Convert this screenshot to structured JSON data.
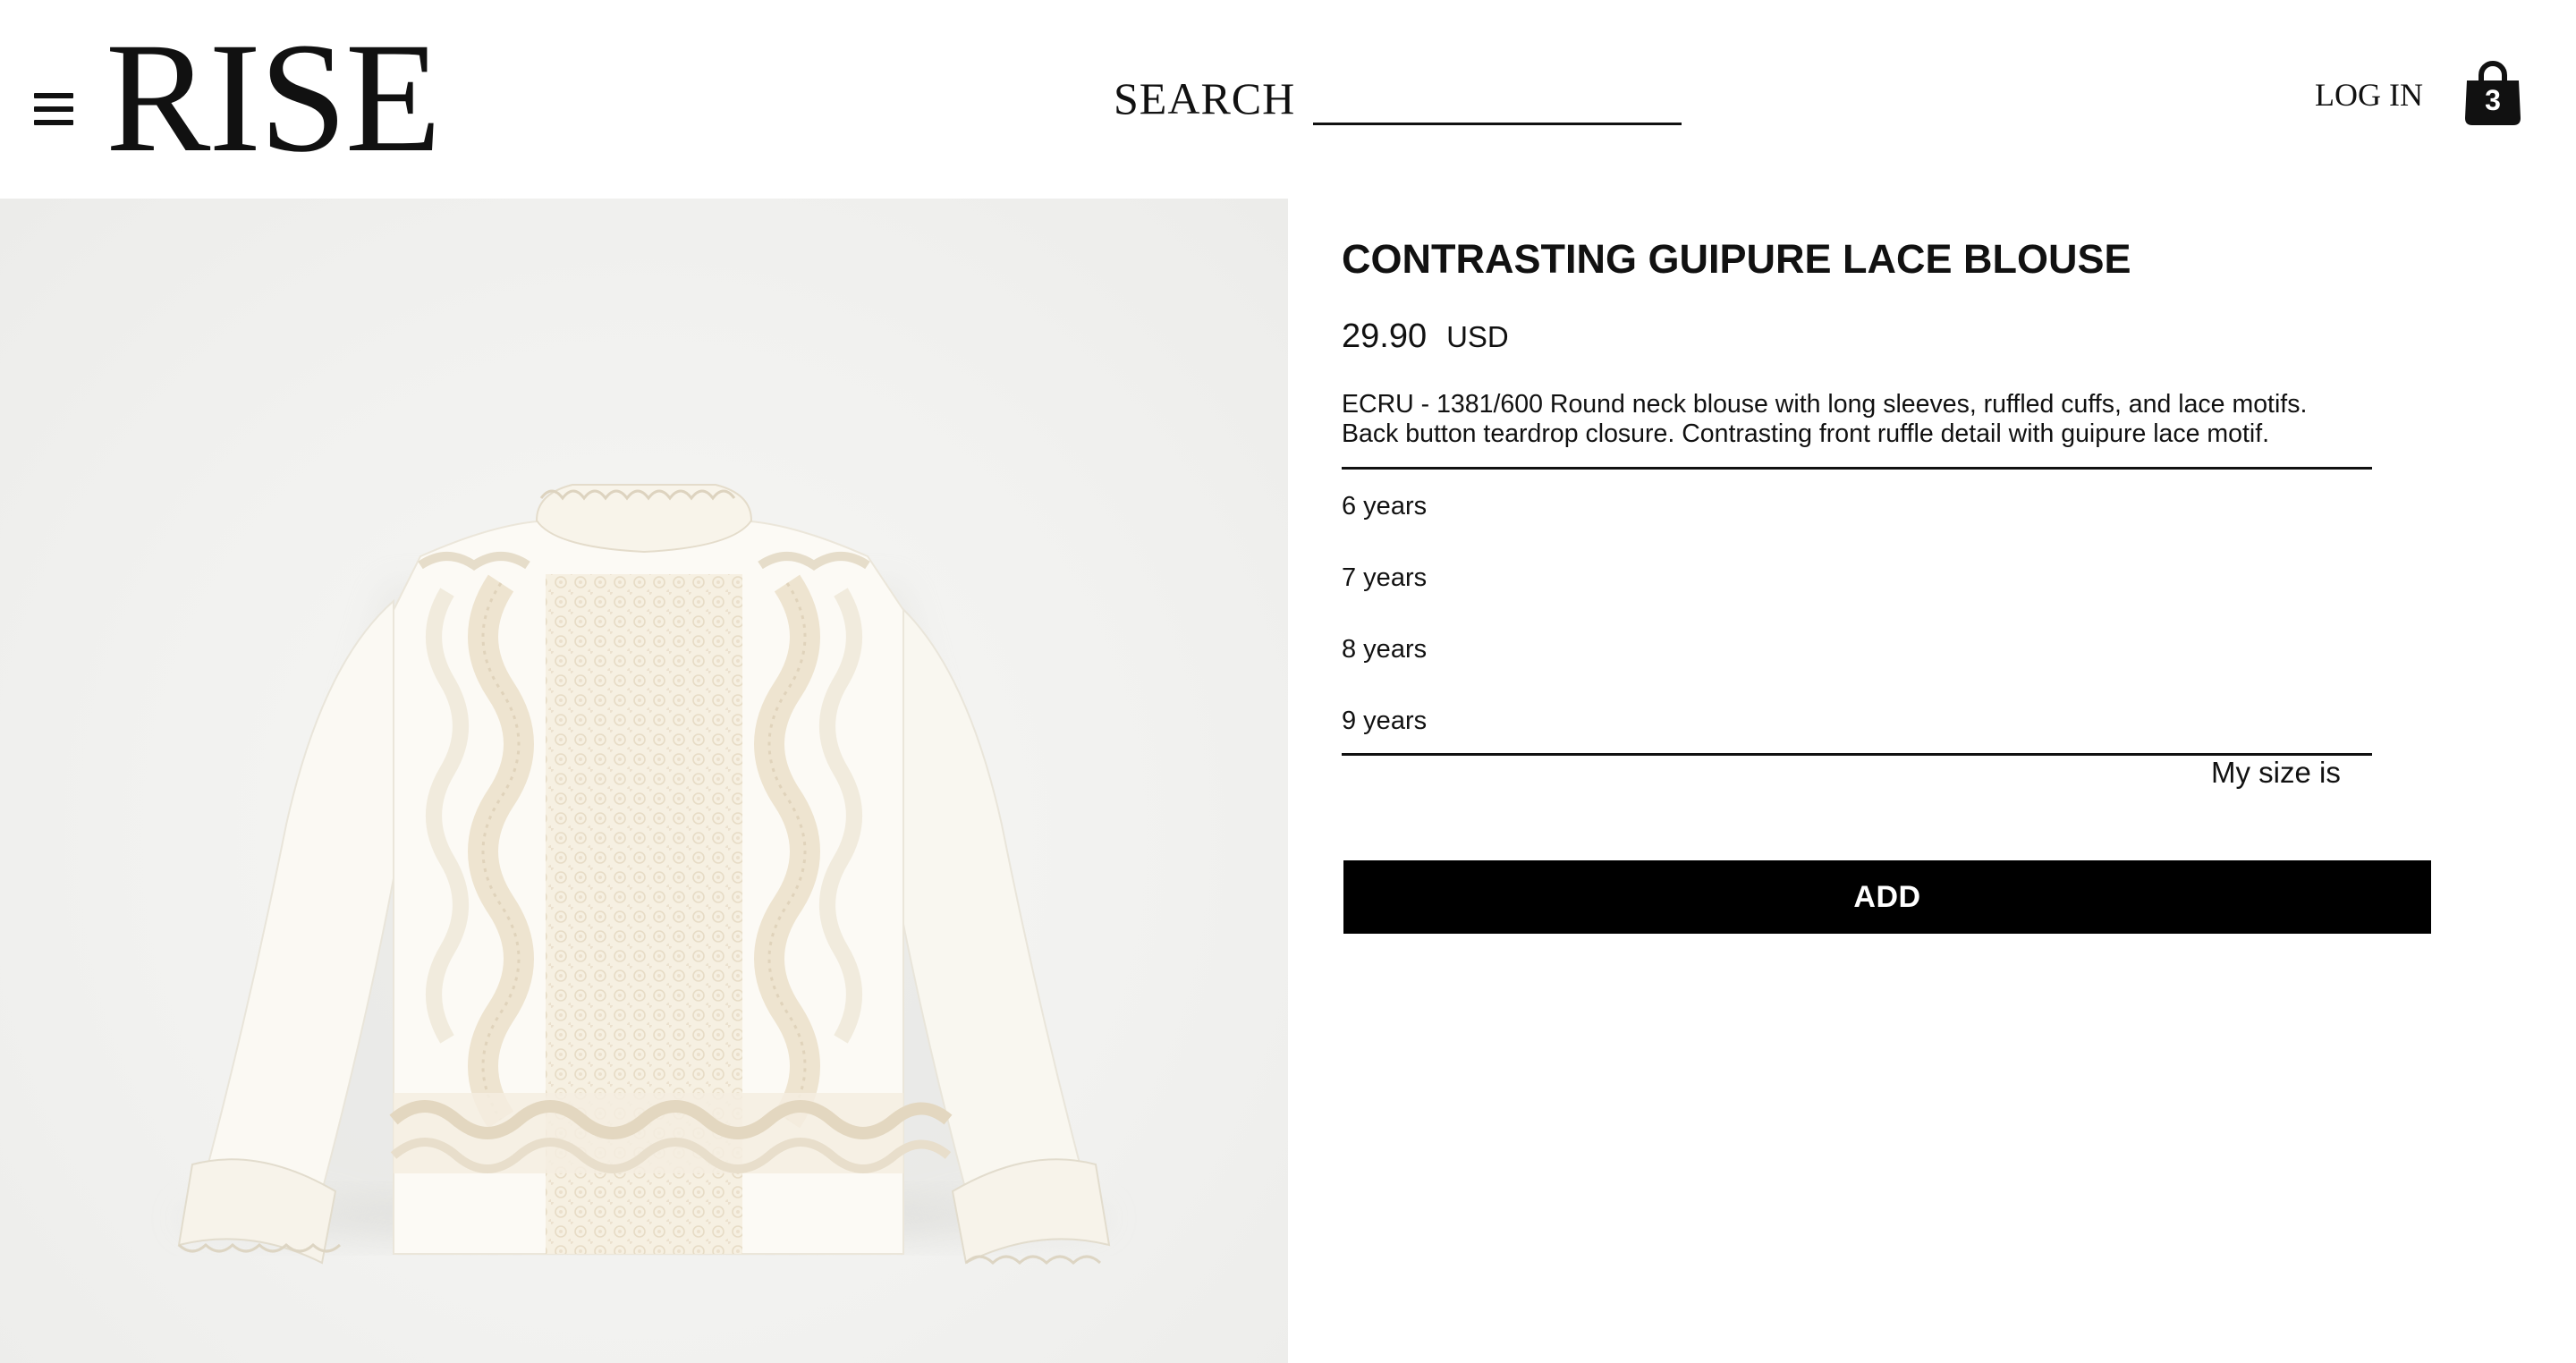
{
  "header": {
    "logo": "RISE",
    "search_label": "SEARCH",
    "search_value": "",
    "login_label": "LOG IN",
    "cart_count": "3",
    "icons": {
      "menu": "hamburger-menu-icon",
      "cart": "shopping-bag-icon"
    }
  },
  "product": {
    "image_alt": "Contrasting guipure lace blouse",
    "title": "CONTRASTING GUIPURE LACE BLOUSE",
    "price": "29.90",
    "currency": "USD",
    "description_line1": "ECRU - 1381/600 Round neck blouse with long sleeves, ruffled cuffs, and lace motifs.",
    "description_line2": "Back button teardrop closure. Contrasting front ruffle detail with guipure lace motif.",
    "sizes": [
      "6 years",
      "7 years",
      "8 years",
      "9 years"
    ],
    "size_selector_label": "My size is",
    "add_label": "ADD"
  },
  "colors": {
    "text": "#111111",
    "button_bg": "#000000",
    "button_text": "#ffffff",
    "image_bg": "#f1f1ef",
    "garment": "#f8f4ea"
  }
}
